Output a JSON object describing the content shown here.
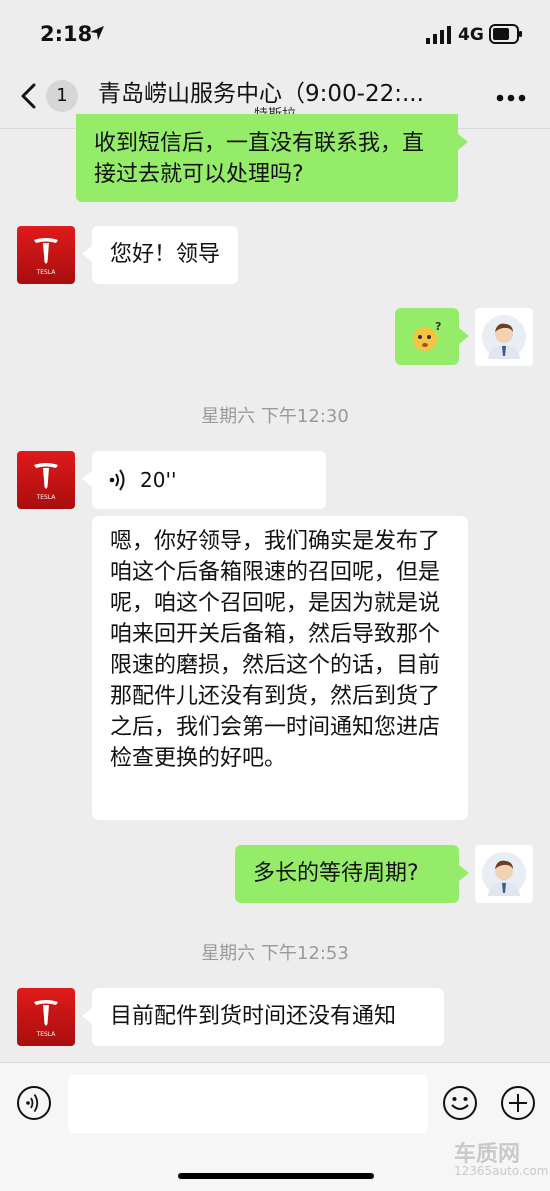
{
  "status_bar": {
    "time": "2:18",
    "network": "4G"
  },
  "nav": {
    "unread_count": "1",
    "title": "青岛崂山服务中心（9:00-22:...",
    "subtitle": "特斯拉"
  },
  "messages": {
    "m1": "收到短信后，一直没有联系我，直接过去就可以处理吗?",
    "m2": "您好！领导",
    "ts1": "星期六 下午12:30",
    "voice_duration": "20''",
    "m4": "嗯，你好领导，我们确实是发布了咱这个后备箱限速的召回呢，但是呢，咱这个召回呢，是因为就是说咱来回开关后备箱，然后导致那个限速的磨损，然后这个的话，目前那配件儿还没有到货，然后到货了之后，我们会第一时间通知您进店检查更换的好吧。",
    "m5": "多长的等待周期?",
    "ts2": "星期六 下午12:53",
    "m6": "目前配件到货时间还没有通知"
  },
  "avatars": {
    "tesla_text": "TESLA"
  },
  "watermark": {
    "brand": "车质网",
    "url": "12365auto.com"
  },
  "colors": {
    "self_bubble": "#95ec69",
    "other_bubble": "#ffffff",
    "background": "#ededed",
    "tesla_red": "#cc1111"
  }
}
